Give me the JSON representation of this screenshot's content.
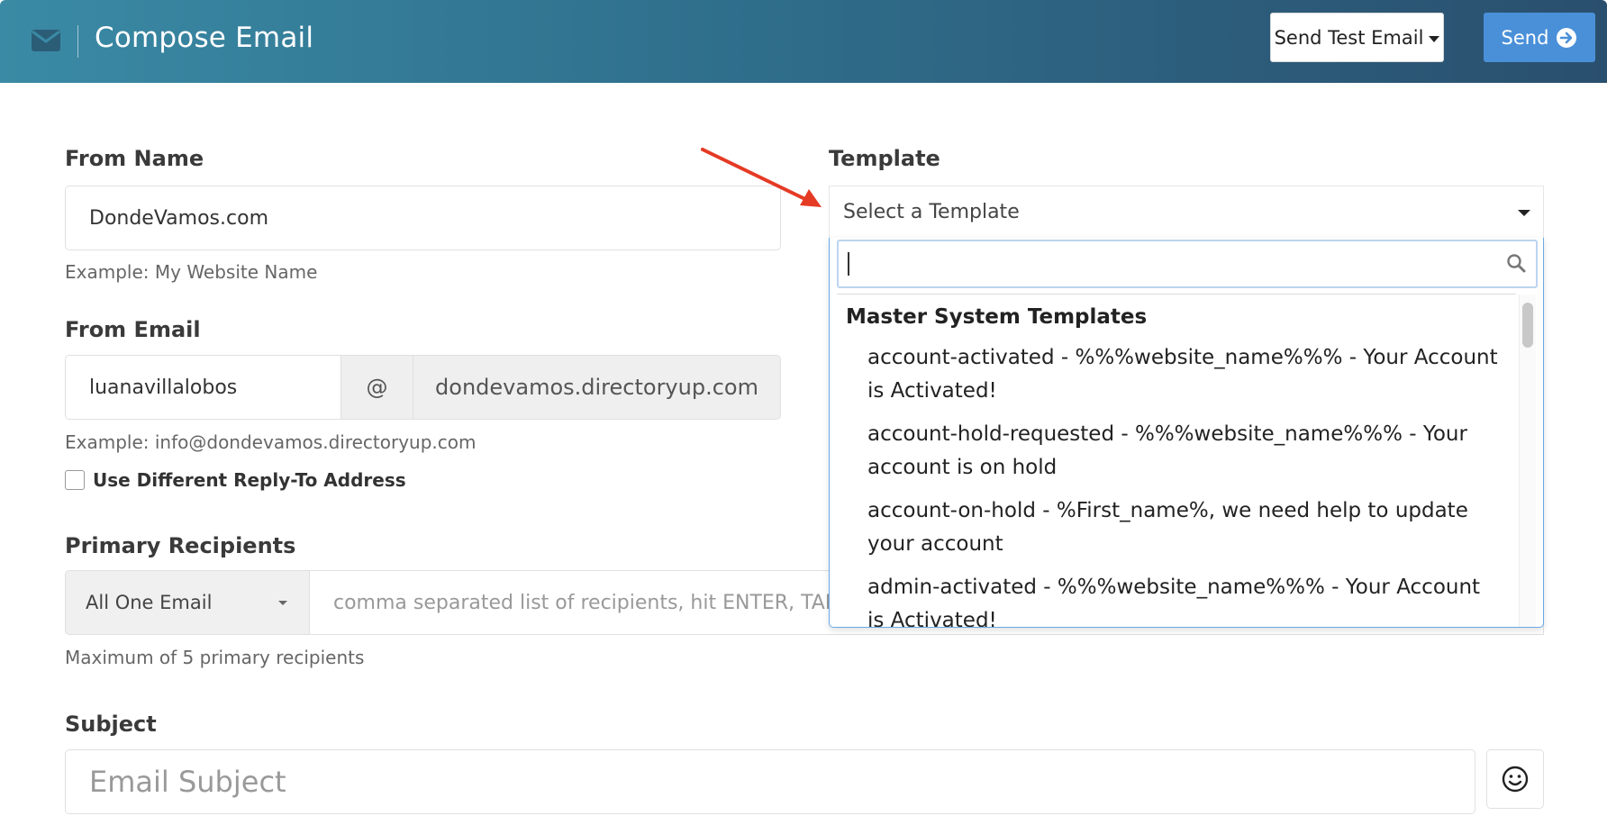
{
  "header": {
    "title": "Compose Email",
    "send_test_label": "Send Test Email",
    "send_label": "Send",
    "mail_icon": "mail-icon",
    "colors": {
      "gradient_start": "#3a8aa5",
      "gradient_end": "#2a4f6e",
      "send_button": "#4a90d9"
    }
  },
  "from_name": {
    "label": "From Name",
    "value": "DondeVamos.com",
    "help": "Example: My Website Name"
  },
  "from_email": {
    "label": "From Email",
    "local_part": "luanavillalobos",
    "at_symbol": "@",
    "domain": "dondevamos.directoryup.com",
    "help": "Example: info@dondevamos.directoryup.com",
    "reply_to_label": "Use Different Reply-To Address",
    "reply_to_checked": false
  },
  "recipients": {
    "label": "Primary Recipients",
    "mode_value": "All One Email",
    "placeholder": "comma separated list of recipients, hit ENTER, TAB",
    "help": "Maximum of 5 primary recipients"
  },
  "subject": {
    "label": "Subject",
    "placeholder": "Email Subject",
    "emoji_icon": "smiley-icon"
  },
  "template": {
    "label": "Template",
    "placeholder": "Select a Template",
    "search_value": "",
    "group": "Master System Templates",
    "options": [
      "account-activated - %%%website_name%%% - Your Account is Activated!",
      "account-hold-requested - %%%website_name%%% - Your account is on hold",
      "account-on-hold - %First_name%, we need help to update your account",
      "admin-activated - %%%website_name%%% - Your Account is Activated!"
    ]
  }
}
